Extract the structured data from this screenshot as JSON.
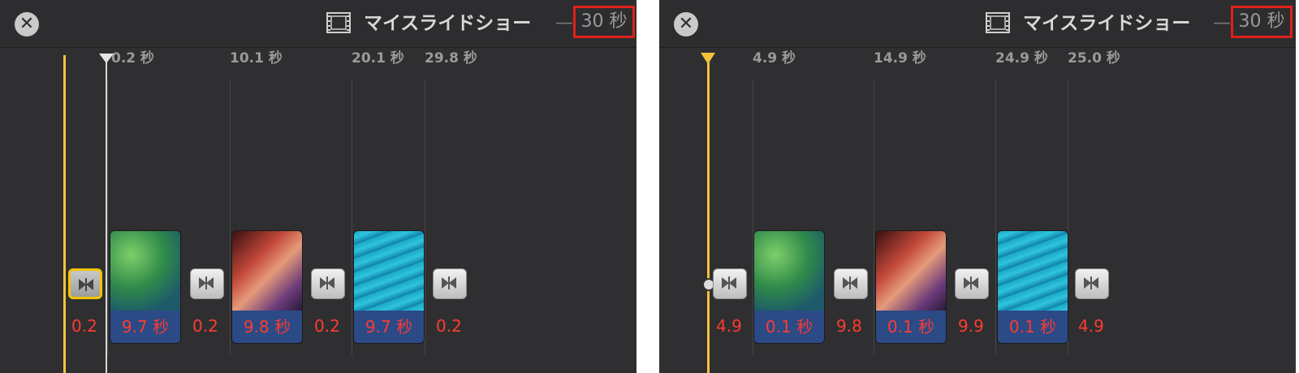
{
  "left": {
    "title": "マイスライドショー",
    "dash": "—",
    "duration": "30 秒",
    "ticks": [
      "0.2 秒",
      "10.1 秒",
      "20.1 秒",
      "29.8 秒"
    ],
    "clips": [
      "9.7 秒",
      "9.8 秒",
      "9.7 秒"
    ],
    "transitions": [
      "0.2",
      "0.2",
      "0.2",
      "0.2"
    ]
  },
  "right": {
    "title": "マイスライドショー",
    "dash": "—",
    "duration": "30 秒",
    "ticks": [
      "4.9 秒",
      "14.9 秒",
      "24.9 秒",
      "25.0 秒"
    ],
    "clips": [
      "0.1 秒",
      "0.1 秒",
      "0.1 秒"
    ],
    "transitions": [
      "4.9",
      "9.8",
      "9.9",
      "4.9"
    ]
  },
  "icons": {
    "close": "close-circle-icon",
    "film": "film-strip-icon",
    "transition": "bowtie-transition-icon"
  },
  "colors": {
    "playhead": "#f2c33a",
    "highlight_box": "#e0201a",
    "duration_text": "#ff3b30",
    "clip_label_bg": "#2b4a86"
  }
}
